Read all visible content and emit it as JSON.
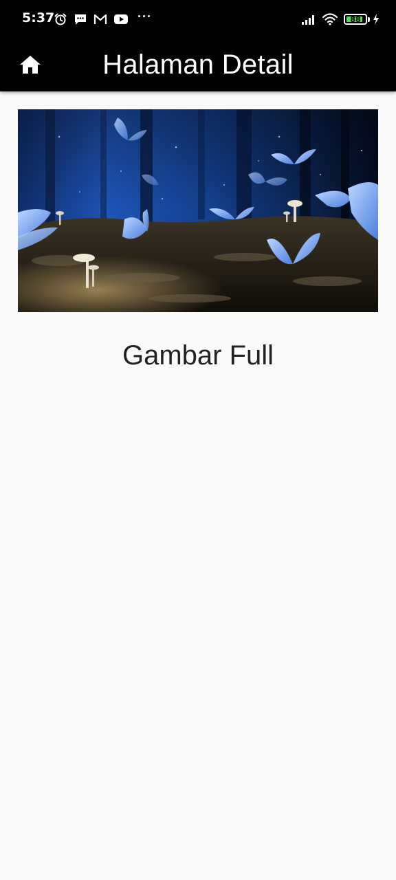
{
  "status_bar": {
    "time": "5:37",
    "more": "···",
    "battery_level": "88",
    "icons_left": [
      "alarm-icon",
      "message-icon",
      "gmail-icon",
      "youtube-icon"
    ],
    "icons_right": [
      "signal-icon",
      "wifi-icon",
      "battery-icon",
      "charging-icon"
    ]
  },
  "app_bar": {
    "title": "Halaman Detail",
    "home_icon": "home-icon",
    "background": "#000000",
    "text_color": "#ffffff"
  },
  "content": {
    "image_alt": "Blue butterflies and glowing mushrooms in a dark forest",
    "caption": "Gambar Full",
    "background": "#fafafa"
  }
}
